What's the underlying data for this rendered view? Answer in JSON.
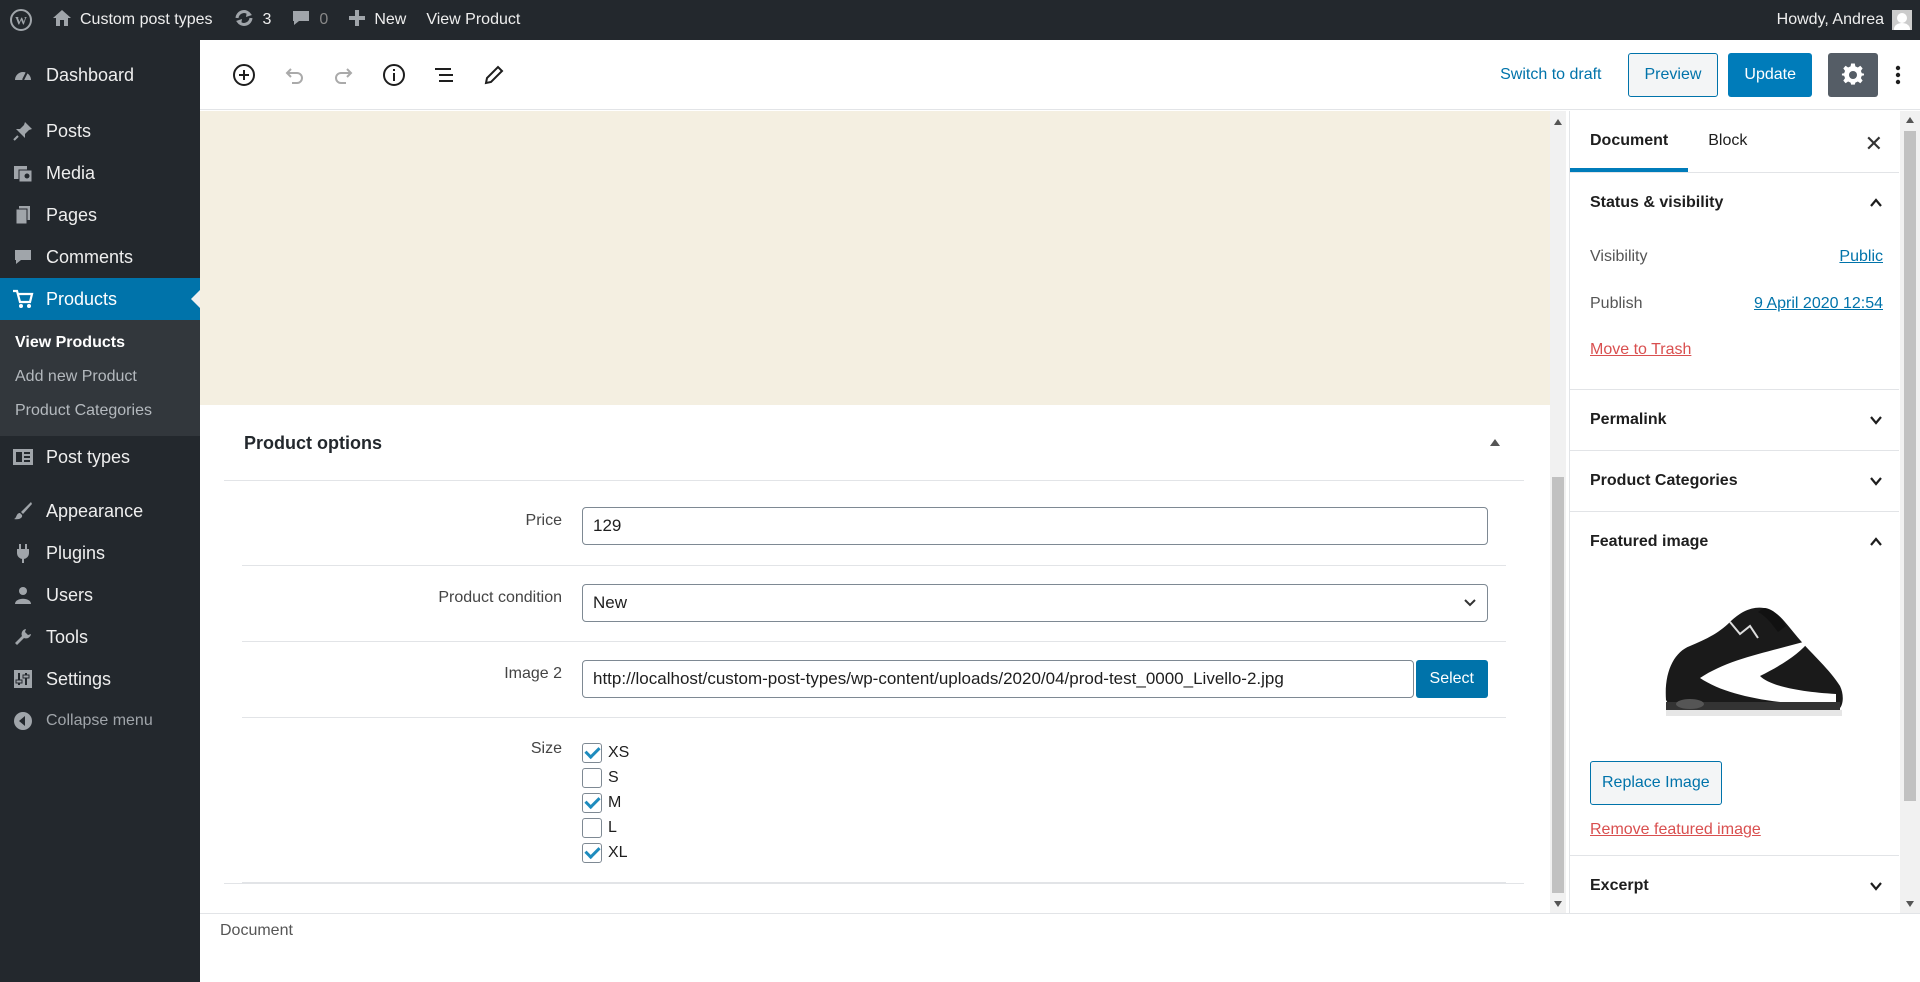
{
  "adminbar": {
    "site_name": "Custom post types",
    "updates_count": "3",
    "comments_count": "0",
    "new_label": "New",
    "view_label": "View Product",
    "howdy": "Howdy, Andrea"
  },
  "sidebar": {
    "items": [
      {
        "label": "Dashboard",
        "icon": "dashboard-icon"
      },
      {
        "label": "Posts",
        "icon": "pin-icon"
      },
      {
        "label": "Media",
        "icon": "media-icon"
      },
      {
        "label": "Pages",
        "icon": "pages-icon"
      },
      {
        "label": "Comments",
        "icon": "comments-icon"
      },
      {
        "label": "Products",
        "icon": "cart-icon"
      },
      {
        "label": "Post types",
        "icon": "post-types-icon"
      },
      {
        "label": "Appearance",
        "icon": "brush-icon"
      },
      {
        "label": "Plugins",
        "icon": "plugin-icon"
      },
      {
        "label": "Users",
        "icon": "users-icon"
      },
      {
        "label": "Tools",
        "icon": "wrench-icon"
      },
      {
        "label": "Settings",
        "icon": "settings-icon"
      }
    ],
    "submenu": [
      "View Products",
      "Add new Product",
      "Product Categories"
    ],
    "collapse_label": "Collapse menu"
  },
  "header": {
    "switch_to_draft": "Switch to draft",
    "preview": "Preview",
    "update": "Update"
  },
  "metabox": {
    "title": "Product options",
    "price_label": "Price",
    "price_value": "129",
    "condition_label": "Product condition",
    "condition_value": "New",
    "image2_label": "Image 2",
    "image2_value": "http://localhost/custom-post-types/wp-content/uploads/2020/04/prod-test_0000_Livello-2.jpg",
    "select_button": "Select",
    "size_label": "Size",
    "sizes": [
      {
        "label": "XS",
        "checked": true
      },
      {
        "label": "S",
        "checked": false
      },
      {
        "label": "M",
        "checked": true
      },
      {
        "label": "L",
        "checked": false
      },
      {
        "label": "XL",
        "checked": true
      }
    ]
  },
  "footer": {
    "breadcrumb": "Document"
  },
  "settings": {
    "tab_document": "Document",
    "tab_block": "Block",
    "status_title": "Status & visibility",
    "visibility_label": "Visibility",
    "visibility_value": "Public",
    "publish_label": "Publish",
    "publish_value": "9 April 2020 12:54",
    "move_to_trash": "Move to Trash",
    "permalink_title": "Permalink",
    "categories_title": "Product Categories",
    "featured_title": "Featured image",
    "replace_image": "Replace Image",
    "remove_featured": "Remove featured image",
    "excerpt_title": "Excerpt"
  },
  "colors": {
    "accent": "#0073aa",
    "admin_dark": "#23282d",
    "cover_bg": "#f4efe1",
    "danger": "#d94f4f"
  }
}
